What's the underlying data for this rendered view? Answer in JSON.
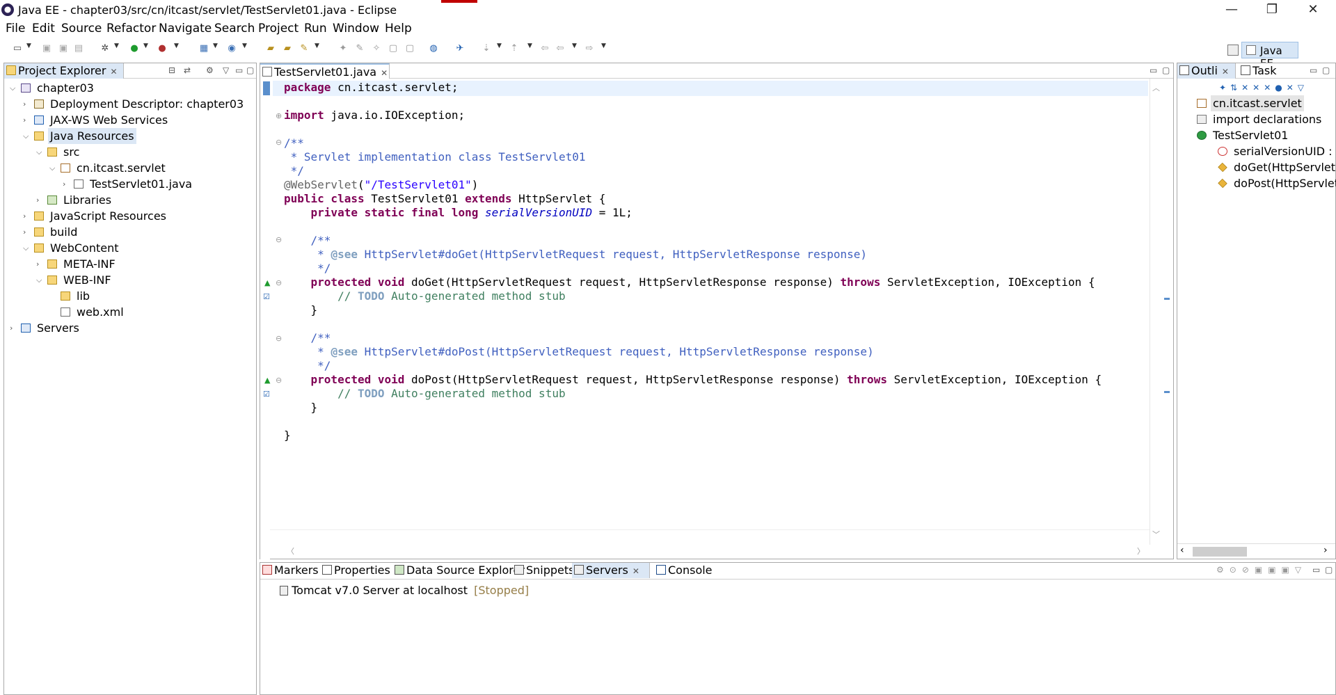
{
  "window": {
    "title": "Java EE - chapter03/src/cn/itcast/servlet/TestServlet01.java - Eclipse",
    "minimize": "—",
    "restore": "❐",
    "close": "✕"
  },
  "menu": [
    "File",
    "Edit",
    "Source",
    "Refactor",
    "Navigate",
    "Search",
    "Project",
    "Run",
    "Window",
    "Help"
  ],
  "perspective": {
    "label": "Java EE"
  },
  "project_explorer": {
    "tab_label": "Project Explorer",
    "tree": [
      {
        "label": "chapter03",
        "depth": 0,
        "expanded": true,
        "icon": "project-icon"
      },
      {
        "label": "Deployment Descriptor: chapter03",
        "depth": 1,
        "expanded": false,
        "icon": "descriptor-icon"
      },
      {
        "label": "JAX-WS Web Services",
        "depth": 1,
        "expanded": false,
        "icon": "webservice-icon"
      },
      {
        "label": "Java Resources",
        "depth": 1,
        "expanded": true,
        "icon": "java-resources-icon",
        "selected": true
      },
      {
        "label": "src",
        "depth": 2,
        "expanded": true,
        "icon": "source-folder-icon"
      },
      {
        "label": "cn.itcast.servlet",
        "depth": 3,
        "expanded": true,
        "icon": "package-icon"
      },
      {
        "label": "TestServlet01.java",
        "depth": 4,
        "expanded": false,
        "icon": "java-file-icon"
      },
      {
        "label": "Libraries",
        "depth": 2,
        "expanded": false,
        "icon": "libraries-icon"
      },
      {
        "label": "JavaScript Resources",
        "depth": 1,
        "expanded": false,
        "icon": "js-resources-icon"
      },
      {
        "label": "build",
        "depth": 1,
        "expanded": false,
        "icon": "folder-icon"
      },
      {
        "label": "WebContent",
        "depth": 1,
        "expanded": true,
        "icon": "folder-icon"
      },
      {
        "label": "META-INF",
        "depth": 2,
        "expanded": false,
        "icon": "folder-icon"
      },
      {
        "label": "WEB-INF",
        "depth": 2,
        "expanded": true,
        "icon": "folder-icon"
      },
      {
        "label": "lib",
        "depth": 3,
        "leaf": true,
        "icon": "folder-icon"
      },
      {
        "label": "web.xml",
        "depth": 3,
        "leaf": true,
        "icon": "xml-file-icon"
      },
      {
        "label": "Servers",
        "depth": 0,
        "expanded": false,
        "icon": "servers-folder-icon"
      }
    ]
  },
  "editor": {
    "tab_label": "TestServlet01.java",
    "lines": [
      {
        "y": 0,
        "html": "<span class='kw'>package</span> cn.itcast.servlet;"
      },
      {
        "y": 1,
        "html": "<span class='kw'>import</span> java.io.IOException;"
      },
      {
        "y": 2,
        "html": "<span class='jd'>/**</span>"
      },
      {
        "y": 3,
        "html": "<span class='jd'> * Servlet implementation class TestServlet01</span>"
      },
      {
        "y": 4,
        "html": "<span class='jd'> */</span>"
      },
      {
        "y": 5,
        "html": "<span class='ann'>@WebServlet</span>(<span class='str'>\"/TestServlet01\"</span>)"
      },
      {
        "y": 6,
        "html": "<span class='kw'>public class</span> TestServlet01 <span class='kw'>extends</span> HttpServlet {"
      },
      {
        "y": 7,
        "html": "    <span class='kw'>private static final long</span> <span class='fld'>serialVersionUID</span> = 1L;"
      },
      {
        "y": 8,
        "html": "    <span class='jd'>/**</span>"
      },
      {
        "y": 9,
        "html": "<span class='jd'>     * </span><span class='jdt'>@see</span><span class='jd'> HttpServlet#doGet(HttpServletRequest request, HttpServletResponse response)</span>"
      },
      {
        "y": 10,
        "html": "<span class='jd'>     */</span>"
      },
      {
        "y": 11,
        "html": "    <span class='kw'>protected void</span> doGet(HttpServletRequest request, HttpServletResponse response) <span class='kw'>throws</span> ServletException, IOException {"
      },
      {
        "y": 12,
        "html": "        <span class='cm'>// </span><span class='jdt'>TODO</span><span class='cm'> Auto-generated method stub</span>"
      },
      {
        "y": 13,
        "html": "    }"
      },
      {
        "y": 14,
        "html": "    <span class='jd'>/**</span>"
      },
      {
        "y": 15,
        "html": "<span class='jd'>     * </span><span class='jdt'>@see</span><span class='jd'> HttpServlet#doPost(HttpServletRequest request, HttpServletResponse response)</span>"
      },
      {
        "y": 16,
        "html": "<span class='jd'>     */</span>"
      },
      {
        "y": 17,
        "html": "    <span class='kw'>protected void</span> doPost(HttpServletRequest request, HttpServletResponse response) <span class='kw'>throws</span> ServletException, IOException {"
      },
      {
        "y": 18,
        "html": "        <span class='cm'>// </span><span class='jdt'>TODO</span><span class='cm'> Auto-generated method stub</span>"
      },
      {
        "y": 19,
        "html": "    }"
      },
      {
        "y": 20,
        "html": "}"
      }
    ]
  },
  "outline": {
    "tab_outline": "Outli",
    "tab_task": "Task",
    "items": [
      {
        "label": "cn.itcast.servlet",
        "icon": "package-icon"
      },
      {
        "label": "import declarations",
        "icon": "imports-icon"
      },
      {
        "label": "TestServlet01",
        "icon": "class-icon"
      },
      {
        "label": "serialVersionUID : lo",
        "icon": "field-icon"
      },
      {
        "label": "doGet(HttpServletR",
        "icon": "method-icon"
      },
      {
        "label": "doPost(HttpServletR",
        "icon": "method-icon"
      }
    ]
  },
  "bottom": {
    "tabs": [
      "Markers",
      "Properties",
      "Data Source Explorer",
      "Snippets",
      "Servers",
      "Console"
    ],
    "server_name": "Tomcat v7.0 Server at localhost",
    "server_status": "[Stopped]"
  },
  "colors": {
    "selection": "#dbe7f5",
    "keyword": "#7f0055",
    "javadoc": "#3f5fbf",
    "comment": "#3f7f5f",
    "string": "#2a00ff"
  }
}
